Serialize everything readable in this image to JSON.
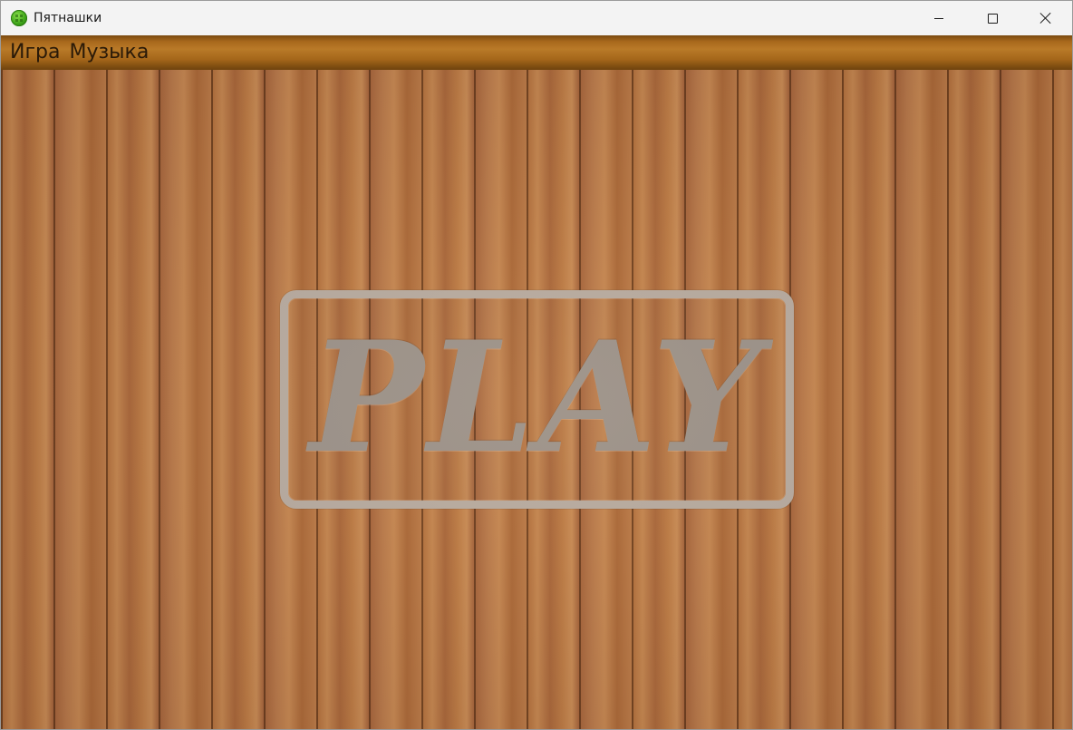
{
  "window": {
    "title": "Пятнашки",
    "icon": "green-puzzle-ball-icon",
    "controls": {
      "minimize": "minimize-icon",
      "maximize": "maximize-icon",
      "close": "close-icon"
    }
  },
  "menu": {
    "items": [
      {
        "label": "Игра"
      },
      {
        "label": "Музыка"
      }
    ]
  },
  "main": {
    "play_button_label": "PLAY"
  },
  "colors": {
    "menubar": "#a8681c",
    "wood": "#b5733f",
    "play_frame": "#b7aca3",
    "play_text": "#9a928c"
  }
}
